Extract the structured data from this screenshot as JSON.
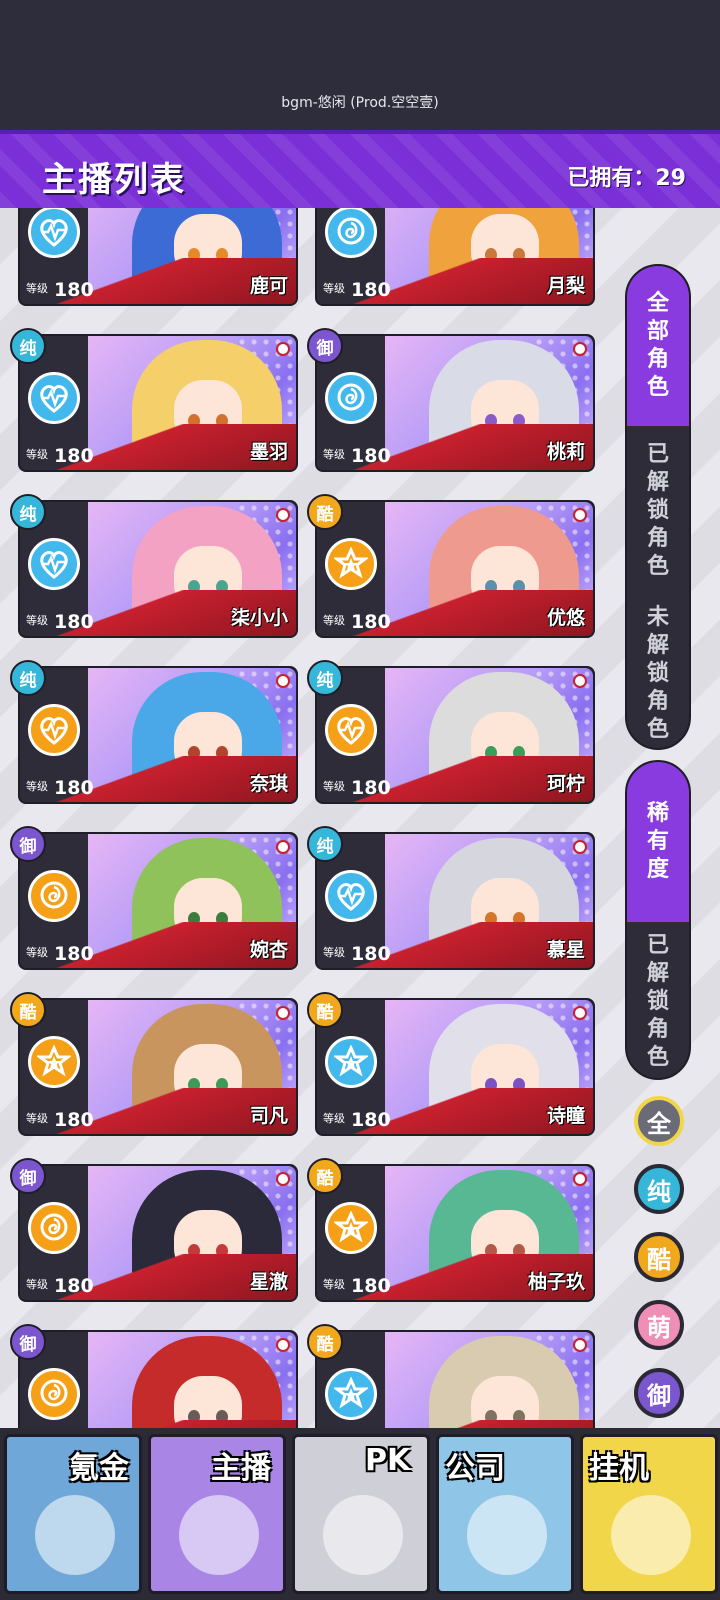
{
  "top": {
    "bgm": "bgm-悠闲 (Prod.空空壹)"
  },
  "header": {
    "title": "主播列表",
    "owned_label": "已拥有：",
    "owned_count": "29"
  },
  "level_label": "等级",
  "cards": [
    {
      "name": "鹿可",
      "level": "180",
      "tag": "",
      "tag_type": "",
      "emblem": "pulse",
      "emblem_color": "blue",
      "hair": "#3d6bd6",
      "eyes": "#e58a2a"
    },
    {
      "name": "月梨",
      "level": "180",
      "tag": "",
      "tag_type": "",
      "emblem": "rose",
      "emblem_color": "blue",
      "hair": "#f0a23c",
      "eyes": "#c9773a"
    },
    {
      "name": "墨羽",
      "level": "180",
      "tag": "纯",
      "tag_type": "pure",
      "emblem": "pulse",
      "emblem_color": "blue",
      "hair": "#f5cf6a",
      "eyes": "#d2702c"
    },
    {
      "name": "桃莉",
      "level": "180",
      "tag": "御",
      "tag_type": "royal",
      "emblem": "rose",
      "emblem_color": "blue",
      "hair": "#d9dbe6",
      "eyes": "#8b5bc9"
    },
    {
      "name": "柒小小",
      "level": "180",
      "tag": "纯",
      "tag_type": "pure",
      "emblem": "pulse",
      "emblem_color": "blue",
      "hair": "#f3a2c3",
      "eyes": "#4aa58f"
    },
    {
      "name": "优悠",
      "level": "180",
      "tag": "酷",
      "tag_type": "cool",
      "emblem": "star",
      "emblem_color": "orange",
      "hair": "#ef9a8e",
      "eyes": "#5c8fa8"
    },
    {
      "name": "奈琪",
      "level": "180",
      "tag": "纯",
      "tag_type": "pure",
      "emblem": "pulse",
      "emblem_color": "orange",
      "hair": "#4aa8e8",
      "eyes": "#b0452e"
    },
    {
      "name": "珂柠",
      "level": "180",
      "tag": "纯",
      "tag_type": "pure",
      "emblem": "pulse",
      "emblem_color": "orange",
      "hair": "#dcdcdc",
      "eyes": "#3a9e5a"
    },
    {
      "name": "婉杏",
      "level": "180",
      "tag": "御",
      "tag_type": "royal",
      "emblem": "rose",
      "emblem_color": "orange",
      "hair": "#8fc25a",
      "eyes": "#3c7c3c"
    },
    {
      "name": "慕星",
      "level": "180",
      "tag": "纯",
      "tag_type": "pure",
      "emblem": "pulse",
      "emblem_color": "blue",
      "hair": "#d6d6de",
      "eyes": "#d4762a"
    },
    {
      "name": "司凡",
      "level": "180",
      "tag": "酷",
      "tag_type": "cool",
      "emblem": "star",
      "emblem_color": "orange",
      "hair": "#c9955e",
      "eyes": "#3f9a5a"
    },
    {
      "name": "诗瞳",
      "level": "180",
      "tag": "酷",
      "tag_type": "cool",
      "emblem": "star",
      "emblem_color": "blue",
      "hair": "#e0dfea",
      "eyes": "#7a52c4"
    },
    {
      "name": "星澈",
      "level": "180",
      "tag": "御",
      "tag_type": "royal",
      "emblem": "rose",
      "emblem_color": "orange",
      "hair": "#2b2a3a",
      "eyes": "#c43a3a"
    },
    {
      "name": "柚子玖",
      "level": "180",
      "tag": "酷",
      "tag_type": "cool",
      "emblem": "star",
      "emblem_color": "orange",
      "hair": "#57b893",
      "eyes": "#b05a4a"
    },
    {
      "name": "",
      "level": "",
      "tag": "御",
      "tag_type": "royal",
      "emblem": "rose",
      "emblem_color": "orange",
      "hair": "#c52b2b",
      "eyes": "#6a5a5a"
    },
    {
      "name": "",
      "level": "",
      "tag": "酷",
      "tag_type": "cool",
      "emblem": "star",
      "emblem_color": "blue",
      "hair": "#d9cbb0",
      "eyes": "#7d7360"
    }
  ],
  "sidebar": {
    "group1": [
      {
        "label": "全部角色",
        "active": true
      },
      {
        "label": "已解锁角色",
        "active": false
      },
      {
        "label": "未解锁角色",
        "active": false
      }
    ],
    "group2": [
      {
        "label": "稀有度",
        "active": true
      },
      {
        "label": "已解锁角色",
        "active": false
      }
    ],
    "filters": [
      {
        "label": "全",
        "color": "#6b6b78",
        "selected": true
      },
      {
        "label": "纯",
        "color": "#36b6d8",
        "selected": false
      },
      {
        "label": "酷",
        "color": "#f2a81d",
        "selected": false
      },
      {
        "label": "萌",
        "color": "#f08fb6",
        "selected": false
      },
      {
        "label": "御",
        "color": "#7b56cf",
        "selected": false
      }
    ]
  },
  "nav": [
    {
      "label": "氪金",
      "bg": "#6fa8d8",
      "icon": "coins-icon"
    },
    {
      "label": "主播",
      "bg": "#a986e6",
      "icon": "streamer-icon"
    },
    {
      "label": "PK",
      "bg": "#cfcfd8",
      "icon": "pk-icon"
    },
    {
      "label": "公司",
      "bg": "#8fc6e8",
      "icon": "building-icon"
    },
    {
      "label": "挂机",
      "bg": "#f2d64a",
      "icon": "piggy-icon"
    }
  ]
}
